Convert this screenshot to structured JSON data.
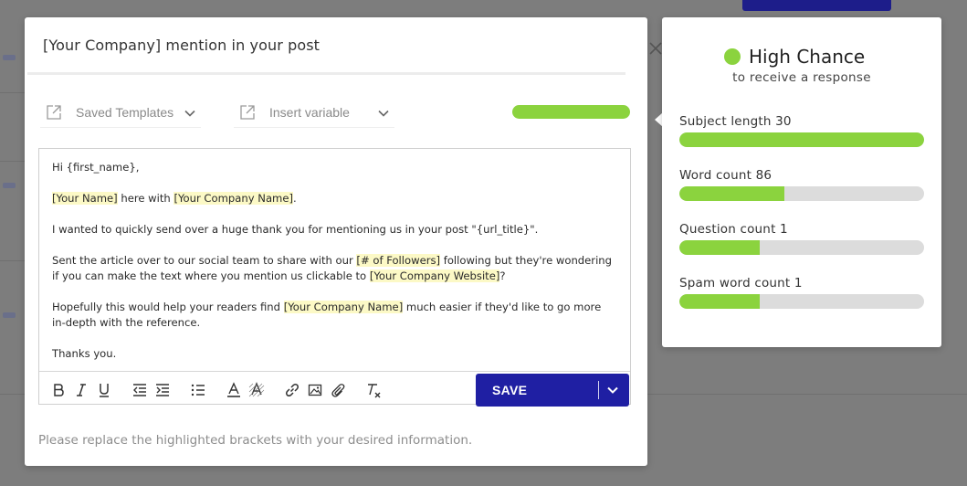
{
  "modal": {
    "title": "[Your Company] mention in your post",
    "saved_templates_label": "Saved Templates",
    "insert_variable_label": "Insert variable",
    "editor_paragraphs": [
      [
        {
          "t": "Hi {first_name},"
        }
      ],
      [
        {
          "t": "[Your Name]",
          "h": true
        },
        {
          "t": " here with "
        },
        {
          "t": "[Your Company Name]",
          "h": true
        },
        {
          "t": "."
        }
      ],
      [
        {
          "t": "I wanted to quickly send over a huge thank you for mentioning us in your post \"{url_title}\"."
        }
      ],
      [
        {
          "t": "Sent the article over to our social team to share with our "
        },
        {
          "t": "[# of Followers]",
          "h": true
        },
        {
          "t": " following but they're wondering if you can make the text where you mention us clickable to "
        },
        {
          "t": "[Your Company Website]",
          "h": true
        },
        {
          "t": "?"
        }
      ],
      [
        {
          "t": "Hopefully this would help your readers find "
        },
        {
          "t": "[Your Company Name]",
          "h": true
        },
        {
          "t": " much easier if they'd like to go more in-depth with the reference."
        }
      ],
      [
        {
          "t": "Thanks you."
        }
      ]
    ],
    "toolbar_icons": [
      "bold-icon",
      "italic-icon",
      "underline-icon",
      "outdent-icon",
      "indent-icon",
      "bullet-list-icon",
      "font-color-icon",
      "highlight-icon",
      "link-icon",
      "image-icon",
      "attachment-icon",
      "clear-format-icon"
    ],
    "save_label": "SAVE",
    "hint": "Please replace the highlighted brackets with your desired information."
  },
  "score_panel": {
    "title": "High Chance",
    "subtitle": "to receive a response",
    "metrics": [
      {
        "label": "Subject length 30",
        "fill": 1.0
      },
      {
        "label": "Word count 86",
        "fill": 0.43
      },
      {
        "label": "Question count 1",
        "fill": 0.33
      },
      {
        "label": "Spam word count 1",
        "fill": 0.33
      }
    ]
  },
  "colors": {
    "accent_green": "#8bd33e",
    "save_blue": "#1f1fa3",
    "highlight": "#fcf9c6"
  }
}
